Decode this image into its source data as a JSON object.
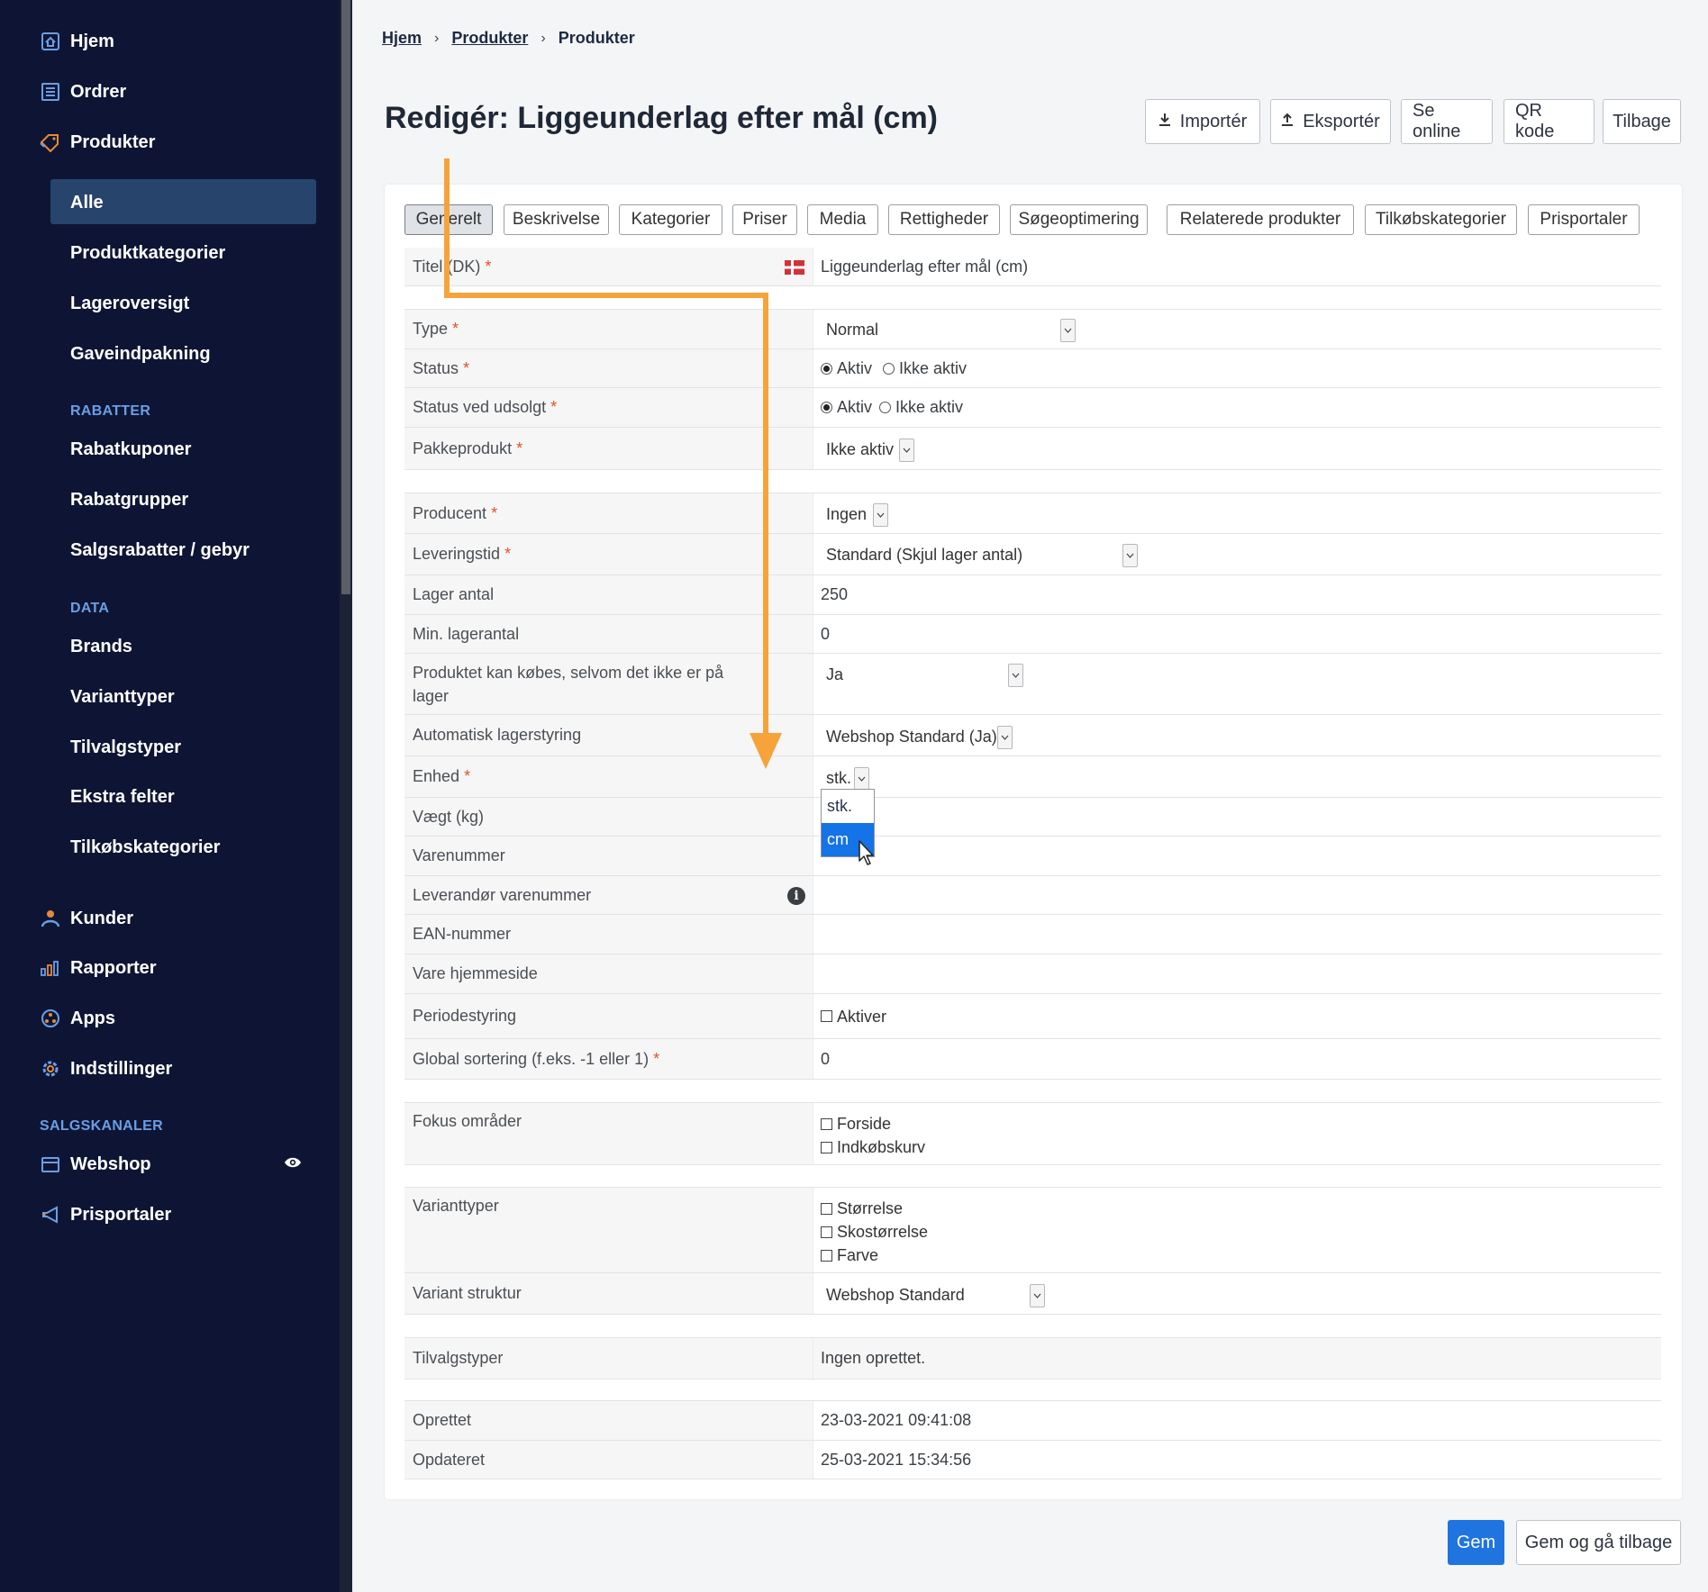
{
  "sidebar": {
    "main": [
      {
        "label": "Hjem",
        "icon": "home-icon"
      },
      {
        "label": "Ordrer",
        "icon": "orders-icon"
      },
      {
        "label": "Produkter",
        "icon": "tag-icon"
      }
    ],
    "products_sub": [
      "Alle",
      "Produktkategorier",
      "Lageroversigt",
      "Gaveindpakning"
    ],
    "rabatter_title": "RABATTER",
    "rabatter": [
      "Rabatkuponer",
      "Rabatgrupper",
      "Salgsrabatter / gebyr"
    ],
    "data_title": "DATA",
    "data": [
      "Brands",
      "Varianttyper",
      "Tilvalgstyper",
      "Ekstra felter",
      "Tilkøbskategorier"
    ],
    "lower": [
      {
        "label": "Kunder",
        "icon": "user-icon"
      },
      {
        "label": "Rapporter",
        "icon": "chart-icon"
      },
      {
        "label": "Apps",
        "icon": "apps-icon"
      },
      {
        "label": "Indstillinger",
        "icon": "gear-icon"
      }
    ],
    "channels_title": "SALGSKANALER",
    "channels": [
      {
        "label": "Webshop",
        "icon": "shop-icon"
      },
      {
        "label": "Prisportaler",
        "icon": "megaphone-icon"
      }
    ]
  },
  "breadcrumb": [
    "Hjem",
    "Produkter",
    "Produkter"
  ],
  "page_title": "Redigér: Liggeunderlag efter mål (cm)",
  "top_buttons": {
    "import": "Importér",
    "export": "Eksportér",
    "online": "Se online",
    "qr": "QR kode",
    "back": "Tilbage"
  },
  "tabs": [
    "Generelt",
    "Beskrivelse",
    "Kategorier",
    "Priser",
    "Media",
    "Rettigheder",
    "Søgeoptimering",
    "Relaterede produkter",
    "Tilkøbskategorier",
    "Prisportaler"
  ],
  "form": {
    "title_label": "Titel (DK)",
    "title_value": "Liggeunderlag efter mål (cm)",
    "type_label": "Type",
    "type_value": "Normal",
    "status_label": "Status",
    "status_on": "Aktiv",
    "status_off": "Ikke aktiv",
    "soldout_label": "Status ved udsolgt",
    "soldout_on": "Aktiv",
    "soldout_off": "Ikke aktiv",
    "package_label": "Pakkeprodukt",
    "package_value": "Ikke aktiv",
    "producer_label": "Producent",
    "producer_value": "Ingen",
    "delivery_label": "Leveringstid",
    "delivery_value": "Standard (Skjul lager antal)",
    "stock_label": "Lager antal",
    "stock_value": "250",
    "minstock_label": "Min. lagerantal",
    "minstock_value": "0",
    "backorder_label": "Produktet kan købes, selvom det ikke er på lager",
    "backorder_value": "Ja",
    "autostock_label": "Automatisk lagerstyring",
    "autostock_value": "Webshop Standard (Ja)",
    "unit_label": "Enhed",
    "unit_value": "stk.",
    "unit_options": [
      "stk.",
      "cm"
    ],
    "weight_label": "Vægt (kg)",
    "sku_label": "Varenummer",
    "supplier_sku_label": "Leverandør varenummer",
    "ean_label": "EAN-nummer",
    "homepage_label": "Vare hjemmeside",
    "period_label": "Periodestyring",
    "period_value": "Aktiver",
    "sort_label": "Global sortering (f.eks. -1 eller 1)",
    "sort_value": "0",
    "focus_label": "Fokus områder",
    "focus_options": [
      "Forside",
      "Indkøbskurv"
    ],
    "variant_types_label": "Varianttyper",
    "variant_types_options": [
      "Størrelse",
      "Skostørrelse",
      "Farve"
    ],
    "variant_structure_label": "Variant struktur",
    "variant_structure_value": "Webshop Standard",
    "addon_label": "Tilvalgstyper",
    "addon_value": "Ingen oprettet.",
    "created_label": "Oprettet",
    "created_value": "23-03-2021 09:41:08",
    "updated_label": "Opdateret",
    "updated_value": "25-03-2021 15:34:56"
  },
  "footer_buttons": {
    "save": "Gem",
    "save_back": "Gem og gå tilbage"
  },
  "colors": {
    "sidebar_bg": "#0e1534",
    "active_item": "#27446c",
    "section_title": "#6a9fe4",
    "primary": "#1f74e0",
    "annotation_arrow": "#f6a33a"
  }
}
